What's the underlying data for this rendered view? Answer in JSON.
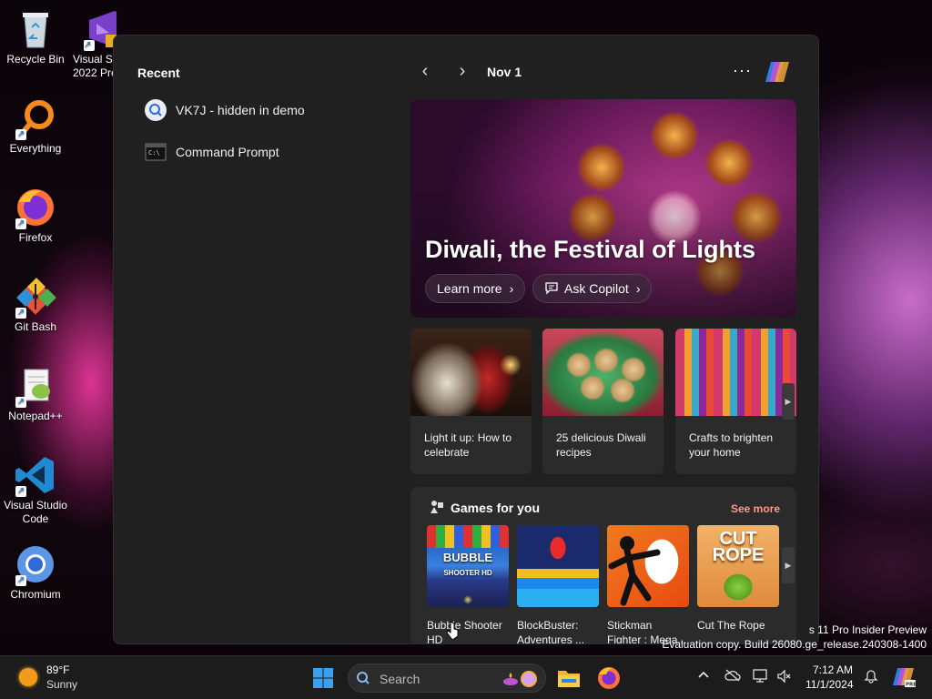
{
  "desktop": {
    "icons": [
      {
        "label": "Recycle Bin"
      },
      {
        "label": "Visual St 2022 Pre"
      },
      {
        "label": "Everything"
      },
      {
        "label": "Firefox"
      },
      {
        "label": "Git Bash"
      },
      {
        "label": "Notepad++"
      },
      {
        "label": "Visual Studio Code"
      },
      {
        "label": "Chromium"
      }
    ]
  },
  "panel": {
    "recent_title": "Recent",
    "recent": [
      {
        "label": "VK7J - hidden in demo",
        "icon": "search-icon"
      },
      {
        "label": "Command Prompt",
        "icon": "terminal-icon"
      }
    ],
    "nav": {
      "prev": "‹",
      "next": "›",
      "date": "Nov 1",
      "more": "···"
    },
    "hero": {
      "title": "Diwali, the Festival of Lights",
      "learn_more": "Learn more",
      "ask_copilot": "Ask Copilot"
    },
    "cards": [
      {
        "text": "Light it up: How to celebrate"
      },
      {
        "text": "25 delicious Diwali recipes"
      },
      {
        "text": "Crafts to brighten your home"
      }
    ],
    "games": {
      "title": "Games for you",
      "see_more": "See more",
      "items": [
        {
          "name": "Bubble Shooter HD"
        },
        {
          "name": "BlockBuster: Adventures ..."
        },
        {
          "name": "Stickman Fighter : Mega..."
        },
        {
          "name": "Cut The Rope"
        }
      ]
    }
  },
  "watermark": {
    "line1": "s 11 Pro Insider Preview",
    "line2": "Evaluation copy. Build 26080.ge_release.240308-1400"
  },
  "taskbar": {
    "weather": {
      "temp": "89°F",
      "condition": "Sunny"
    },
    "search_placeholder": "Search",
    "clock": {
      "time": "7:12 AM",
      "date": "11/1/2024"
    }
  }
}
